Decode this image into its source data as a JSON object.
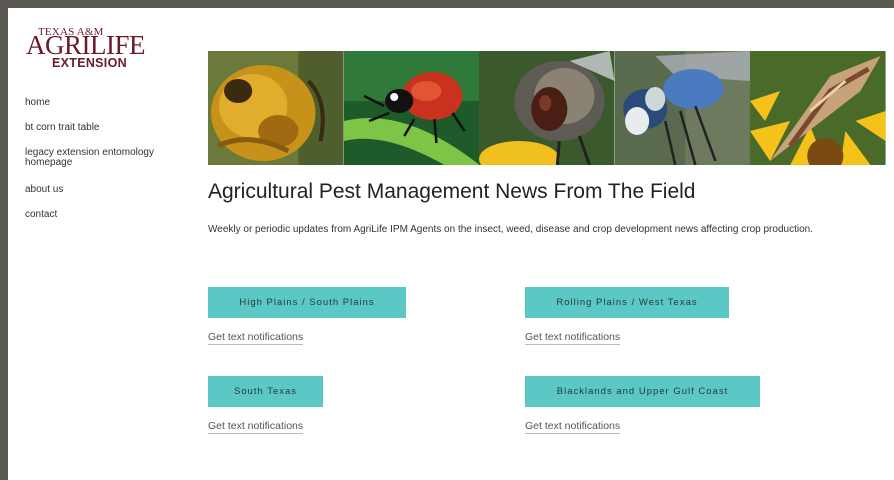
{
  "logo": {
    "line1": "TEXAS A&M",
    "line2": "AGRILIFE",
    "line3": "EXTENSION"
  },
  "nav": {
    "items": [
      "home",
      "bt corn trait table",
      "legacy extension entomology homepage",
      "about us",
      "contact"
    ]
  },
  "banner": {
    "panels": [
      "beetle-photo",
      "ladybug-photo",
      "fly-photo",
      "dragonfly-photo",
      "moth-photo"
    ]
  },
  "main": {
    "title": "Agricultural Pest Management News From The Field",
    "description": "Weekly or periodic updates from AgriLife IPM Agents on the insect, weed, disease and crop development news affecting crop production.",
    "regions": [
      {
        "label": "High Plains / South Plains",
        "notify": "Get text notifications"
      },
      {
        "label": "Rolling Plains / West Texas",
        "notify": "Get text notifications"
      },
      {
        "label": "South Texas",
        "notify": "Get text notifications"
      },
      {
        "label": "Blacklands and Upper Gulf Coast",
        "notify": "Get text notifications"
      }
    ]
  },
  "colors": {
    "button": "#5cc8c6",
    "logo": "#6b1a2a",
    "frame": "#5a5750"
  }
}
